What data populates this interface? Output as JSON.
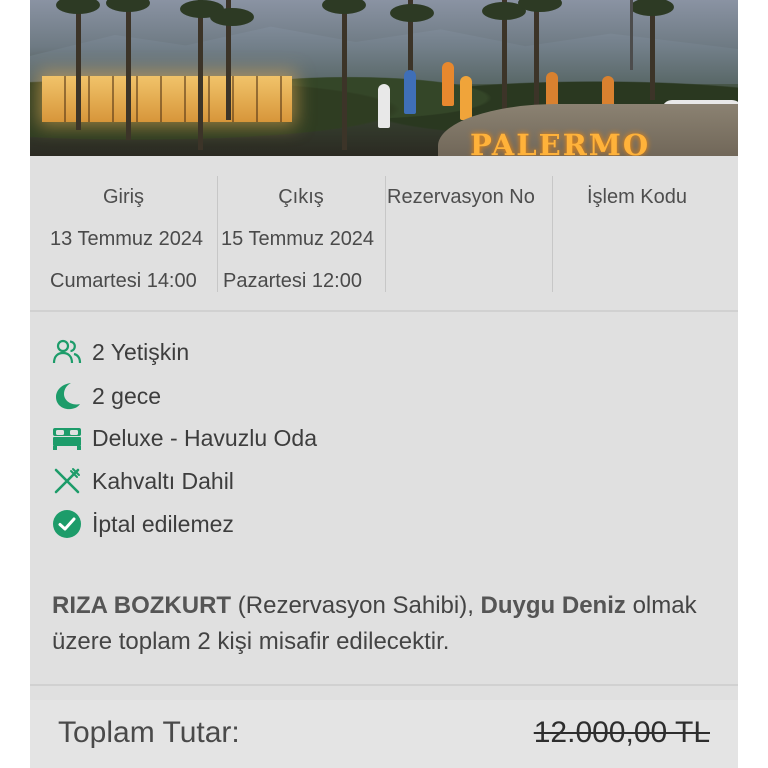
{
  "hero": {
    "sign_text": "PALERMO"
  },
  "booking": {
    "checkin": {
      "title": "Giriş",
      "date": "13 Temmuz 2024",
      "day_time": "Cumartesi 14:00"
    },
    "checkout": {
      "title": "Çıkış",
      "date": "15 Temmuz 2024",
      "day_time": "Pazartesi 12:00"
    },
    "reservation_no": {
      "title": "Rezervasyon No"
    },
    "transaction_code": {
      "title": "İşlem Kodu"
    }
  },
  "details": {
    "guests": {
      "icon": "users-icon",
      "text": "2 Yetişkin"
    },
    "nights": {
      "icon": "moon-icon",
      "text": "2 gece"
    },
    "room": {
      "icon": "bed-icon",
      "text": "Deluxe - Havuzlu Oda"
    },
    "board": {
      "icon": "fork-knife-icon",
      "text": "Kahvaltı Dahil"
    },
    "cancellation": {
      "icon": "check-circle-icon",
      "text": "İptal edilemez"
    }
  },
  "guest_note": {
    "owner_name": "RIZA BOZKURT",
    "owner_role": "(Rezervasyon Sahibi),",
    "guest_name": "Duygu Deniz",
    "sentence": "olmak üzere toplam 2 kişi misafir edilecektir."
  },
  "pricing": {
    "total_label": "Toplam Tutar:",
    "total_original": "12.000,00 TL"
  },
  "colors": {
    "accent_green": "#1d9c6a",
    "panel_bg": "#e0e0e0",
    "sign_orange": "#ffb23a"
  }
}
